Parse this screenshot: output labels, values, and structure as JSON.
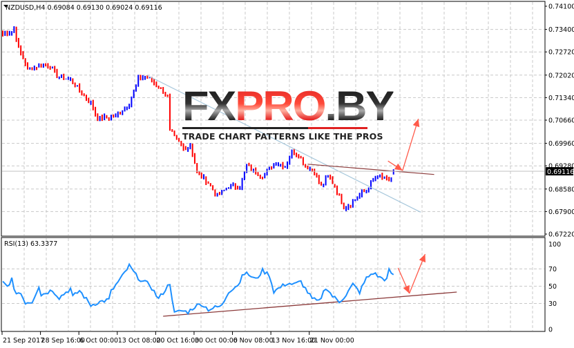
{
  "header": {
    "symbol_line": "NZDUSD,H4  0.69084 0.69130 0.69024 0.69116",
    "rsi_label": "RSI(13) 63.3377"
  },
  "logo": {
    "part1": "FX",
    "part2": "PRO",
    "part3": ".BY",
    "tagline": "TRADE CHART PATTERNS LIKE THE PROS"
  },
  "colors": {
    "bull": "#0000ff",
    "bear": "#ff0000",
    "rsi": "#1e90ff",
    "trend_blue": "#a8c8dc",
    "trend_brown": "#8b3a3a",
    "arrow": "#ff5a4a",
    "grid": "#c8c8c8"
  },
  "chart_data": [
    {
      "type": "bar",
      "title": "NZDUSD,H4",
      "ohlc_last": {
        "open": 0.69084,
        "high": 0.6913,
        "low": 0.69024,
        "close": 0.69116
      },
      "current_price": "0.69116",
      "bar_count": 175,
      "ylim": [
        0.6722,
        0.741
      ],
      "y_ticks": [
        "0.74100",
        "0.73400",
        "0.72720",
        "0.72020",
        "0.71340",
        "0.70660",
        "0.69960",
        "0.69280",
        "0.68580",
        "0.67900",
        "0.67220"
      ],
      "x_ticks": [
        {
          "bar": 0,
          "label": "21 Sep 2017"
        },
        {
          "bar": 17,
          "label": "28 Sep 16:00"
        },
        {
          "bar": 34,
          "label": "6 Oct 00:00"
        },
        {
          "bar": 51,
          "label": "13 Oct 08:00"
        },
        {
          "bar": 68,
          "label": "20 Oct 16:00"
        },
        {
          "bar": 85,
          "label": "30 Oct 00:00"
        },
        {
          "bar": 102,
          "label": "6 Nov 08:00"
        },
        {
          "bar": 119,
          "label": "13 Nov 16:00"
        },
        {
          "bar": 136,
          "label": "21 Nov 00:00"
        }
      ],
      "close_keypoints": [
        [
          0,
          0.7325
        ],
        [
          4,
          0.7335
        ],
        [
          5,
          0.7345
        ],
        [
          7,
          0.7283
        ],
        [
          11,
          0.722
        ],
        [
          16,
          0.7231
        ],
        [
          21,
          0.7231
        ],
        [
          24,
          0.7199
        ],
        [
          30,
          0.7189
        ],
        [
          39,
          0.7116
        ],
        [
          42,
          0.707
        ],
        [
          50,
          0.7078
        ],
        [
          56,
          0.7116
        ],
        [
          60,
          0.7189
        ],
        [
          63,
          0.7199
        ],
        [
          69,
          0.7168
        ],
        [
          73,
          0.7137
        ],
        [
          74,
          0.7033
        ],
        [
          80,
          0.698
        ],
        [
          83,
          0.6991
        ],
        [
          86,
          0.6908
        ],
        [
          91,
          0.6876
        ],
        [
          95,
          0.6835
        ],
        [
          100,
          0.6866
        ],
        [
          105,
          0.6866
        ],
        [
          108,
          0.6928
        ],
        [
          112,
          0.6908
        ],
        [
          115,
          0.6897
        ],
        [
          118,
          0.6918
        ],
        [
          121,
          0.6939
        ],
        [
          125,
          0.6928
        ],
        [
          128,
          0.697
        ],
        [
          131,
          0.696
        ],
        [
          134,
          0.6928
        ],
        [
          138,
          0.6908
        ],
        [
          141,
          0.6866
        ],
        [
          144,
          0.6897
        ],
        [
          147,
          0.6866
        ],
        [
          151,
          0.6803
        ],
        [
          154,
          0.6814
        ],
        [
          157,
          0.6835
        ],
        [
          161,
          0.6855
        ],
        [
          164,
          0.6887
        ],
        [
          167,
          0.6897
        ],
        [
          170,
          0.6883
        ],
        [
          172,
          0.6891
        ],
        [
          173,
          0.69116
        ]
      ],
      "trendlines": [
        {
          "name": "descending-resistance",
          "from": [
            64,
            0.7201
          ],
          "to": [
            185,
            0.6788
          ]
        },
        {
          "name": "neckline",
          "from": [
            135,
            0.6933
          ],
          "to": [
            191,
            0.6902
          ]
        }
      ],
      "arrows": [
        {
          "from": [
            177,
            0.6914
          ],
          "to": [
            184,
            0.707
          ]
        }
      ]
    },
    {
      "type": "line",
      "title": "RSI(13)",
      "value": 63.3377,
      "ylim": [
        0,
        100
      ],
      "y_ticks": [
        "100",
        "70",
        "50",
        "30",
        "0"
      ],
      "keypoints": [
        [
          0,
          54.4
        ],
        [
          2,
          49.6
        ],
        [
          4,
          58.4
        ],
        [
          5,
          44
        ],
        [
          8,
          41.6
        ],
        [
          10,
          31.2
        ],
        [
          13,
          32
        ],
        [
          16,
          50.4
        ],
        [
          17,
          40
        ],
        [
          22,
          45.6
        ],
        [
          25,
          36.8
        ],
        [
          30,
          47.2
        ],
        [
          31,
          37.6
        ],
        [
          34,
          44.8
        ],
        [
          39,
          28
        ],
        [
          42,
          31.2
        ],
        [
          47,
          34.4
        ],
        [
          48,
          44
        ],
        [
          53,
          61.6
        ],
        [
          56,
          73.6
        ],
        [
          59,
          62.4
        ],
        [
          62,
          55.2
        ],
        [
          65,
          52
        ],
        [
          69,
          35.2
        ],
        [
          74,
          53.6
        ],
        [
          76,
          18.4
        ],
        [
          79,
          21.6
        ],
        [
          82,
          20
        ],
        [
          85,
          26.4
        ],
        [
          88,
          29.6
        ],
        [
          91,
          23.2
        ],
        [
          97,
          27.2
        ],
        [
          100,
          44
        ],
        [
          105,
          53.6
        ],
        [
          106,
          65.6
        ],
        [
          109,
          63.2
        ],
        [
          112,
          57.6
        ],
        [
          115,
          68
        ],
        [
          118,
          63.2
        ],
        [
          120,
          44
        ],
        [
          126,
          53.6
        ],
        [
          129,
          52
        ],
        [
          132,
          55.2
        ],
        [
          137,
          35.2
        ],
        [
          140,
          32
        ],
        [
          143,
          48.8
        ],
        [
          146,
          38.4
        ],
        [
          149,
          32
        ],
        [
          152,
          40
        ],
        [
          155,
          52
        ],
        [
          158,
          43.2
        ],
        [
          161,
          59.2
        ],
        [
          164,
          65.6
        ],
        [
          167,
          60
        ],
        [
          170,
          57.6
        ],
        [
          171,
          68
        ],
        [
          173,
          63.3377
        ]
      ],
      "trendline": {
        "from": [
          71,
          15.2
        ],
        "to": [
          201,
          43.2
        ]
      },
      "arrows": [
        {
          "from": [
            175,
            71.2
          ],
          "to": [
            180,
            41.6
          ]
        },
        {
          "from": [
            180,
            41.6
          ],
          "to": [
            187,
            87.2
          ]
        }
      ]
    }
  ]
}
